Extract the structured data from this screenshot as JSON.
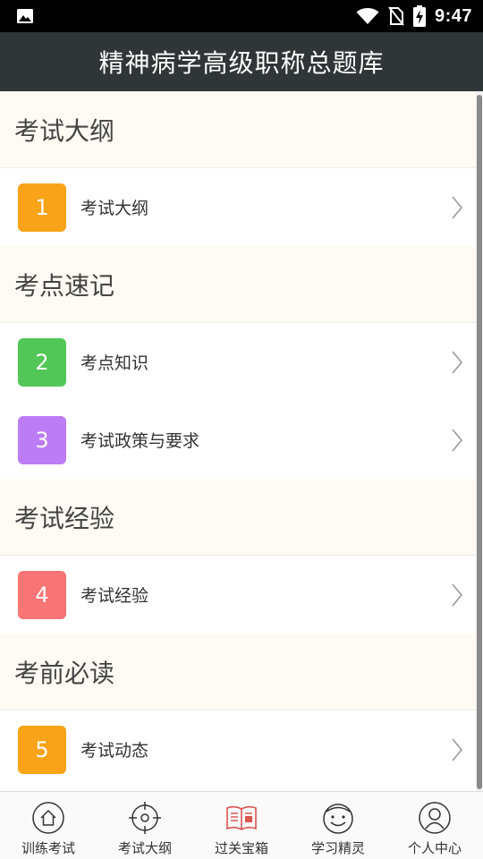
{
  "status_bar": {
    "time": "9:47",
    "icons": [
      "image-icon",
      "wifi-icon",
      "no-sim-icon",
      "battery-charging-icon"
    ]
  },
  "header": {
    "title": "精神病学高级职称总题库"
  },
  "sections": [
    {
      "title": "考试大纲",
      "items": [
        {
          "number": "1",
          "label": "考试大纲",
          "color": "#f9a318"
        }
      ]
    },
    {
      "title": "考点速记",
      "items": [
        {
          "number": "2",
          "label": "考点知识",
          "color": "#52c757"
        },
        {
          "number": "3",
          "label": "考试政策与要求",
          "color": "#bc7cf6"
        }
      ]
    },
    {
      "title": "考试经验",
      "items": [
        {
          "number": "4",
          "label": "考试经验",
          "color": "#f97474"
        }
      ]
    },
    {
      "title": "考前必读",
      "items": [
        {
          "number": "5",
          "label": "考试动态",
          "color": "#f9a318"
        }
      ]
    }
  ],
  "tabs": [
    {
      "label": "训练考试",
      "icon": "home-icon"
    },
    {
      "label": "考试大纲",
      "icon": "target-icon"
    },
    {
      "label": "过关宝箱",
      "icon": "book-icon",
      "accent": "#d9534f"
    },
    {
      "label": "学习精灵",
      "icon": "smiley-icon"
    },
    {
      "label": "个人中心",
      "icon": "person-icon"
    }
  ]
}
